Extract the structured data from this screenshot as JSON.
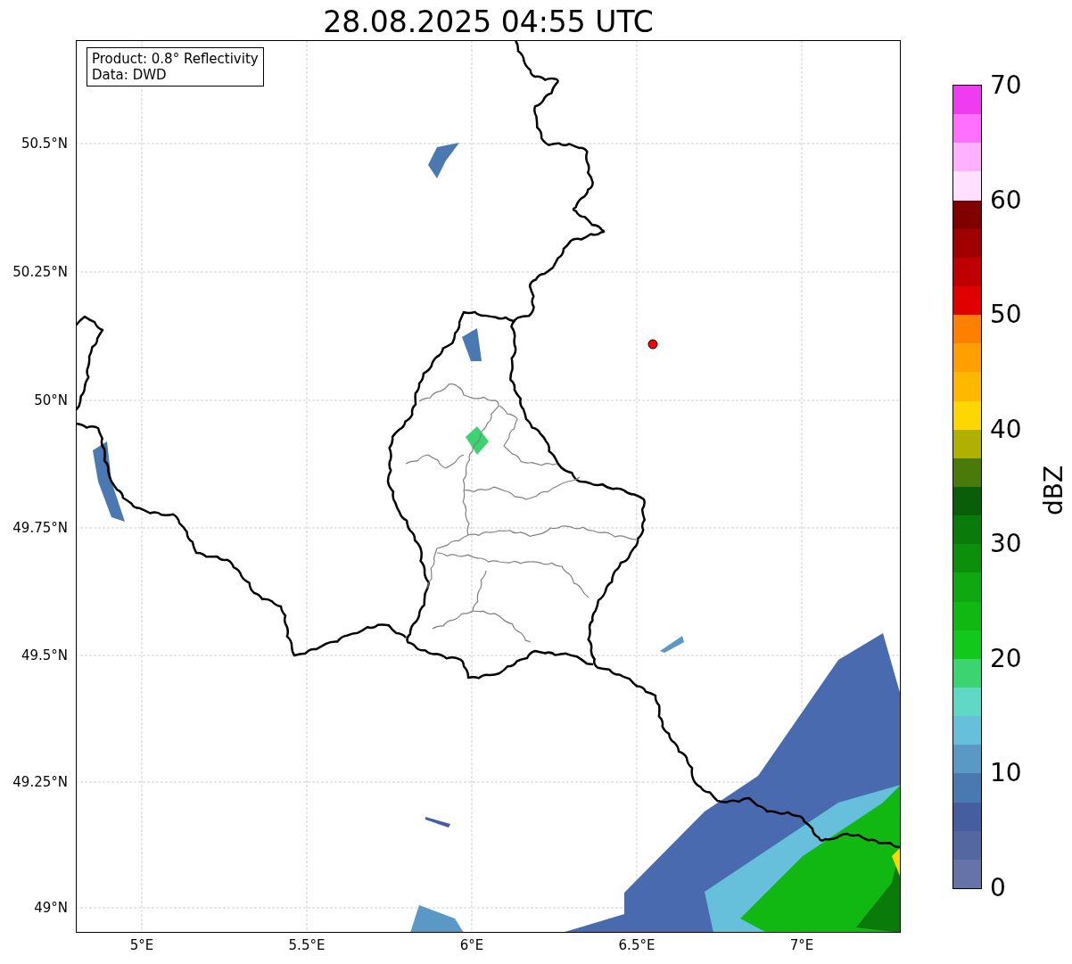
{
  "title": "28.08.2025 04:55 UTC",
  "legend": {
    "lines": [
      "Product: 0.8° Reflectivity",
      "Data: DWD"
    ]
  },
  "map": {
    "yticks": [
      "50.5°N",
      "50.25°N",
      "50°N",
      "49.75°N",
      "49.5°N",
      "49.25°N",
      "49°N"
    ],
    "xticks": [
      "5°E",
      "5.5°E",
      "6°E",
      "6.5°E",
      "7°E"
    ]
  },
  "colorbar": {
    "label": "dBZ",
    "ticks": [
      "70",
      "60",
      "50",
      "40",
      "30",
      "20",
      "10",
      "0"
    ],
    "segments": [
      {
        "color": "#f03cf0"
      },
      {
        "color": "#ff70ff"
      },
      {
        "color": "#ffb0ff"
      },
      {
        "color": "#ffe0ff"
      },
      {
        "color": "#800000"
      },
      {
        "color": "#a00000"
      },
      {
        "color": "#c00000"
      },
      {
        "color": "#e00000"
      },
      {
        "color": "#ff8000"
      },
      {
        "color": "#ffa000"
      },
      {
        "color": "#ffb800"
      },
      {
        "color": "#ffd700"
      },
      {
        "color": "#b0b000"
      },
      {
        "color": "#4a7a0a"
      },
      {
        "color": "#0a5e0a"
      },
      {
        "color": "#0a7a0a"
      },
      {
        "color": "#0c900c"
      },
      {
        "color": "#10a810"
      },
      {
        "color": "#12b812"
      },
      {
        "color": "#12c81a"
      },
      {
        "color": "#3cd471"
      },
      {
        "color": "#60d8c6"
      },
      {
        "color": "#66c0dc"
      },
      {
        "color": "#5a98c6"
      },
      {
        "color": "#4a78b0"
      },
      {
        "color": "#445ea0"
      },
      {
        "color": "#5467a0"
      },
      {
        "color": "#6673a8"
      }
    ]
  }
}
